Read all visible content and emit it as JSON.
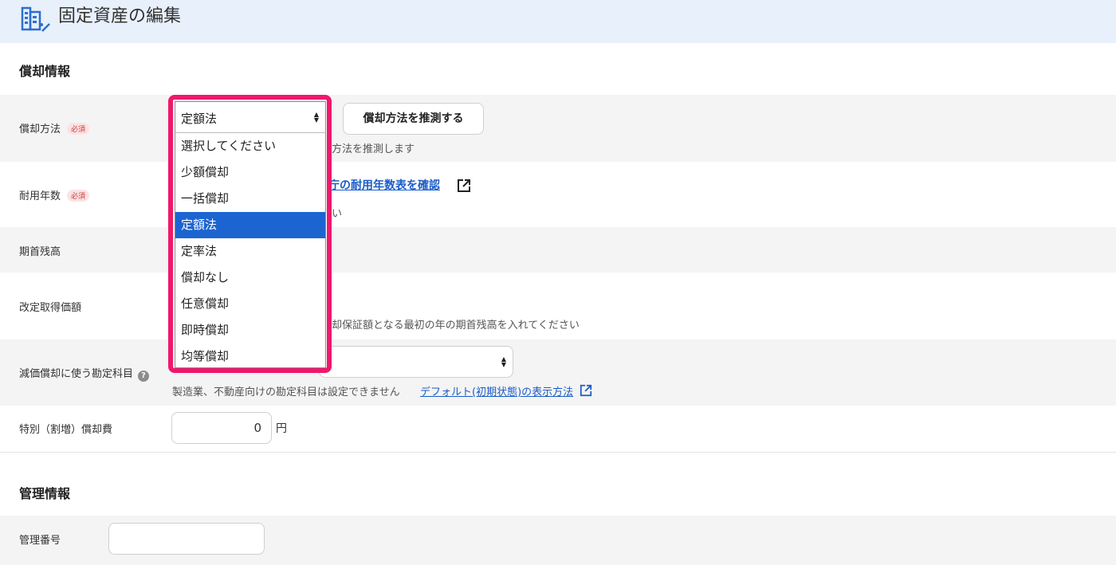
{
  "header": {
    "title": "固定資産の編集",
    "icon": "asset-edit-icon"
  },
  "depreciation_section": {
    "title": "償却情報",
    "required_badge": "必須",
    "method": {
      "label": "償却方法",
      "selected": "定額法",
      "guess_button": "償却方法を推測する",
      "hint_visible": "方法を推測します"
    },
    "useful_life": {
      "label": "耐用年数",
      "link_visible": "庁の耐用年数表を確認",
      "hint_visible": "い"
    },
    "opening_balance": {
      "label": "期首残高"
    },
    "revised_cost": {
      "label": "改定取得価額",
      "hint_visible": "却保証額となる最初の年の期首残高を入れてください"
    },
    "account": {
      "label": "減価償却に使う勘定科目",
      "hint": "製造業、不動産向けの勘定科目は設定できません",
      "default_link": "デフォルト(初期状態)の表示方法"
    },
    "special": {
      "label": "特別（割増）償却費",
      "value": "0",
      "unit": "円"
    }
  },
  "management_section": {
    "title": "管理情報",
    "number": {
      "label": "管理番号",
      "value": ""
    }
  },
  "dropdown": {
    "options": [
      "選択してください",
      "少額償却",
      "一括償却",
      "定額法",
      "定率法",
      "償却なし",
      "任意償却",
      "即時償却",
      "均等償却"
    ],
    "selected_index": 3
  },
  "colors": {
    "highlight": "#f0186b",
    "selected_option": "#1c65d1",
    "link": "#1a5cc8",
    "header_bg": "#e8f0fb"
  }
}
